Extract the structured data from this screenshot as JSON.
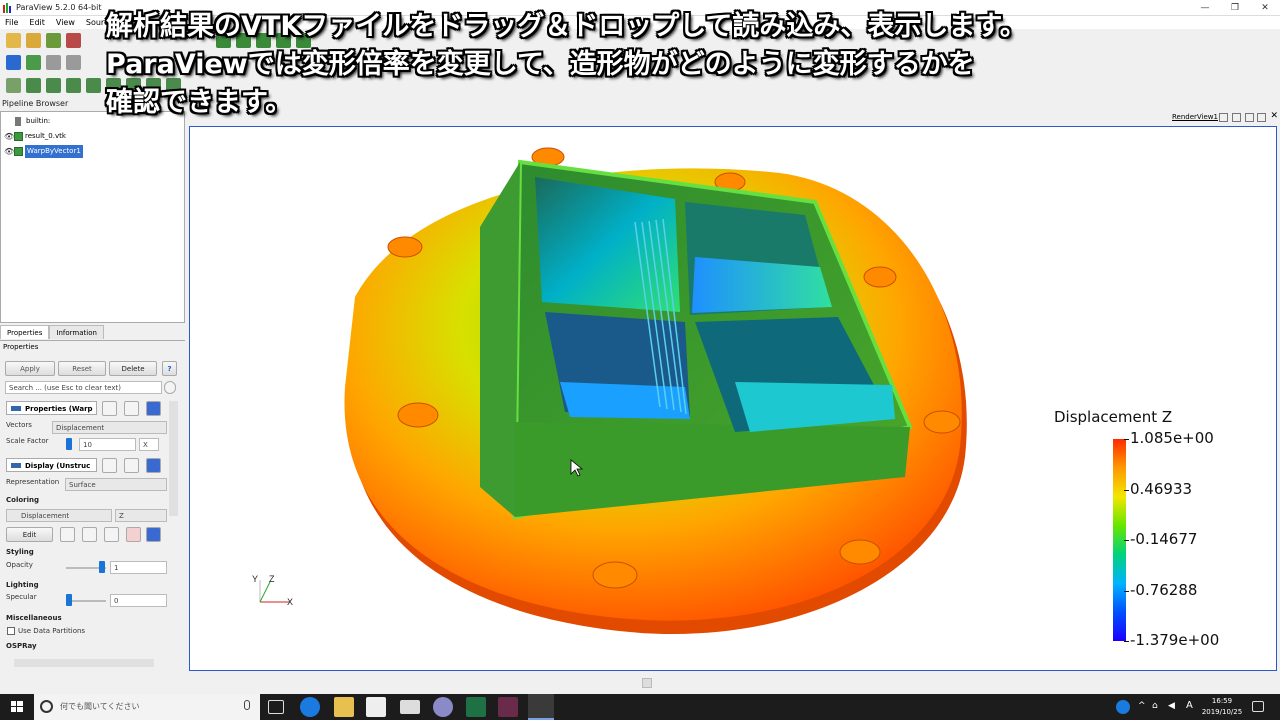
{
  "window": {
    "title": "ParaView 5.2.0 64-bit",
    "minimize": "—",
    "maximize": "❐",
    "close": "✕"
  },
  "menu": [
    "File",
    "Edit",
    "View",
    "Sources"
  ],
  "pipeline_browser": {
    "title": "Pipeline Browser",
    "items": [
      {
        "label": "builtin:"
      },
      {
        "label": "result_0.vtk"
      },
      {
        "label": "WarpByVector1"
      }
    ]
  },
  "tabs": {
    "properties": "Properties",
    "information": "Information"
  },
  "properties_panel": {
    "title": "Properties",
    "apply": "Apply",
    "reset": "Reset",
    "delete": "Delete",
    "help": "?",
    "search_placeholder": "Search ... (use Esc to clear text)",
    "section_properties": "Properties (Warp",
    "vectors_label": "Vectors",
    "vectors_value": "Displacement",
    "scale_factor_label": "Scale Factor",
    "scale_factor_value": "10",
    "scale_factor_unit": "X",
    "section_display": "Display (Unstruc",
    "representation_label": "Representation",
    "representation_value": "Surface",
    "coloring_label": "Coloring",
    "coloring_array": "Displacement",
    "coloring_component": "Z",
    "edit_label": "Edit",
    "styling_label": "Styling",
    "opacity_label": "Opacity",
    "opacity_value": "1",
    "lighting_label": "Lighting",
    "specular_label": "Specular",
    "specular_value": "0",
    "misc_label": "Miscellaneous",
    "use_data_partitions": "Use Data Partitions",
    "ospray_label": "OSPRay"
  },
  "render_view": {
    "label": "RenderView1",
    "colorbar": {
      "title": "Displacement Z",
      "ticks": [
        "1.085e+00",
        "0.46933",
        "-0.14677",
        "-0.76288",
        "-1.379e+00"
      ],
      "colors": [
        "#ff2a00",
        "#ff9900",
        "#f2e600",
        "#66e600",
        "#00d27a",
        "#00b4ff",
        "#0050ff",
        "#1a00ff"
      ]
    },
    "axes": {
      "x": "X",
      "y": "Y",
      "z": "Z"
    }
  },
  "caption": {
    "line1": "解析結果のVTKファイルをドラッグ＆ドロップして読み込み、表示します。",
    "line2": "ParaViewでは変形倍率を変更して、造形物がどのように変形するかを",
    "line3": "確認できます。"
  },
  "taskbar": {
    "search_text": "何でも聞いてください",
    "ime": "A",
    "time": "16:59",
    "date": "2019/10/25"
  }
}
